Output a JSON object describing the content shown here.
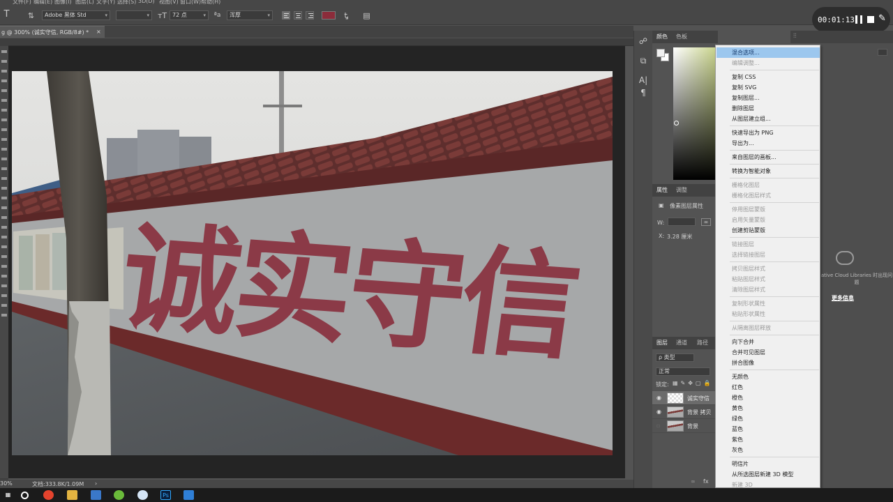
{
  "menubar": {
    "items": [
      "文件(F)",
      "编辑(E)",
      "图像(I)",
      "图层(L)",
      "文字(Y)",
      "选择(S)",
      "3D(D)",
      "视图(V)",
      "窗口(W)",
      "帮助(H)"
    ]
  },
  "options": {
    "font_family": "Adobe 黑体 Std",
    "font_size": "72 点",
    "antialias": "浑厚",
    "text_color": "#8b2c3a"
  },
  "timer": {
    "elapsed": "00:01:13"
  },
  "document": {
    "tab_title": "g @ 300% (诚实守信, RGB/8#) *",
    "close_glyph": "×",
    "status_zoom": "30%",
    "status_doc": "文档:333.8K/1.09M",
    "sign_text": "诚实守信"
  },
  "color_panel": {
    "tabs": [
      "颜色",
      "色板"
    ]
  },
  "properties_panel": {
    "tabs": [
      "属性",
      "调整"
    ],
    "title": "像素图层属性",
    "w_label": "W:",
    "x_label": "X:",
    "x_value": "3.28 厘米"
  },
  "layers_panel": {
    "tabs": [
      "图层",
      "通道",
      "路径"
    ],
    "filter": "ρ 类型",
    "blend_mode": "正常",
    "lock_label": "锁定:",
    "layers": [
      {
        "name": "诚实守信",
        "selected": true
      },
      {
        "name": "背景 拷贝",
        "selected": false
      },
      {
        "name": "背景",
        "selected": false
      }
    ]
  },
  "libraries": {
    "text": "ative Cloud Libraries 时出现问题",
    "link": "更多信息"
  },
  "context_menu": {
    "items": [
      {
        "label": "混合选项...",
        "state": "highlight"
      },
      {
        "label": "编辑调整...",
        "state": "disabled"
      },
      {
        "sep": true
      },
      {
        "label": "复制 CSS",
        "state": "normal"
      },
      {
        "label": "复制 SVG",
        "state": "normal"
      },
      {
        "label": "复制图层...",
        "state": "normal"
      },
      {
        "label": "删除图层",
        "state": "normal"
      },
      {
        "label": "从图层建立组...",
        "state": "normal"
      },
      {
        "sep": true
      },
      {
        "label": "快速导出为 PNG",
        "state": "normal"
      },
      {
        "label": "导出为...",
        "state": "normal"
      },
      {
        "sep": true
      },
      {
        "label": "来自图层的画板...",
        "state": "normal"
      },
      {
        "sep": true
      },
      {
        "label": "转换为智能对象",
        "state": "normal"
      },
      {
        "sep": true
      },
      {
        "label": "栅格化图层",
        "state": "disabled"
      },
      {
        "label": "栅格化图层样式",
        "state": "disabled"
      },
      {
        "sep": true
      },
      {
        "label": "停用图层蒙版",
        "state": "disabled"
      },
      {
        "label": "启用矢量蒙版",
        "state": "disabled"
      },
      {
        "label": "创建剪贴蒙版",
        "state": "normal"
      },
      {
        "sep": true
      },
      {
        "label": "链接图层",
        "state": "disabled"
      },
      {
        "label": "选择链接图层",
        "state": "disabled"
      },
      {
        "sep": true
      },
      {
        "label": "拷贝图层样式",
        "state": "disabled"
      },
      {
        "label": "粘贴图层样式",
        "state": "disabled"
      },
      {
        "label": "清除图层样式",
        "state": "disabled"
      },
      {
        "sep": true
      },
      {
        "label": "复制形状属性",
        "state": "disabled"
      },
      {
        "label": "粘贴形状属性",
        "state": "disabled"
      },
      {
        "sep": true
      },
      {
        "label": "从隔离图层释放",
        "state": "disabled"
      },
      {
        "sep": true
      },
      {
        "label": "向下合并",
        "state": "normal"
      },
      {
        "label": "合并可见图层",
        "state": "normal"
      },
      {
        "label": "拼合图像",
        "state": "normal"
      },
      {
        "sep": true
      },
      {
        "label": "无颜色",
        "state": "normal"
      },
      {
        "label": "红色",
        "state": "normal"
      },
      {
        "label": "橙色",
        "state": "normal"
      },
      {
        "label": "黄色",
        "state": "normal"
      },
      {
        "label": "绿色",
        "state": "normal"
      },
      {
        "label": "蓝色",
        "state": "normal"
      },
      {
        "label": "紫色",
        "state": "normal"
      },
      {
        "label": "灰色",
        "state": "normal"
      },
      {
        "sep": true
      },
      {
        "label": "明信片",
        "state": "normal"
      },
      {
        "label": "从所选图层新建 3D 模型",
        "state": "normal"
      },
      {
        "label": "新建 3D",
        "state": "disabled"
      }
    ]
  }
}
